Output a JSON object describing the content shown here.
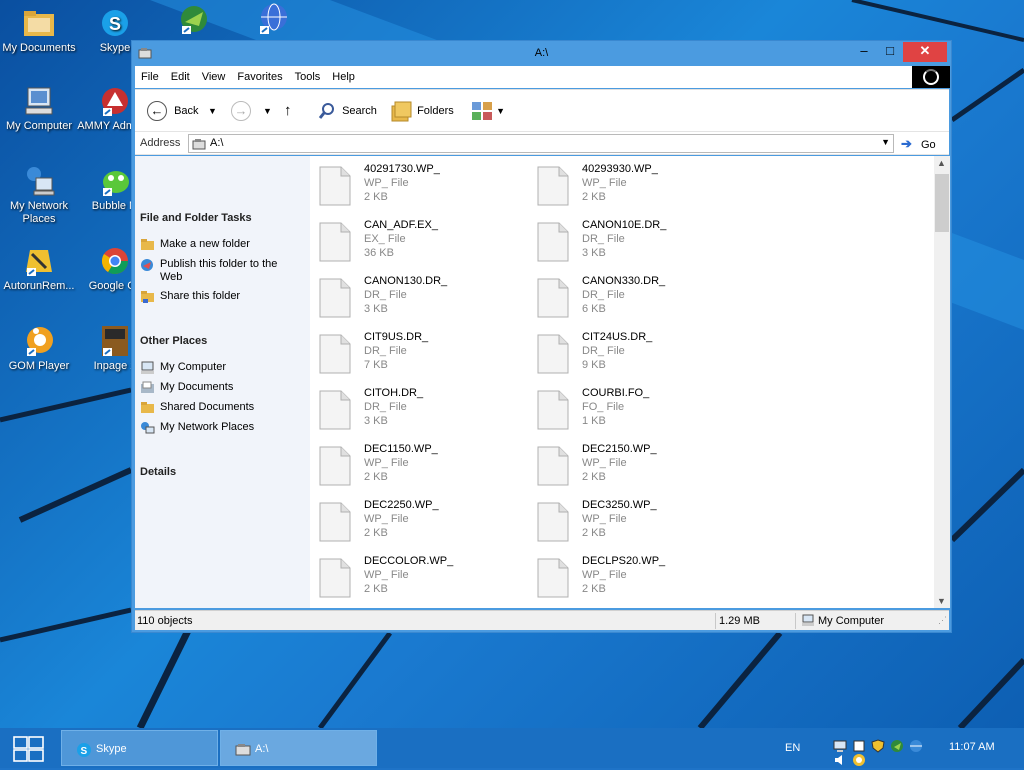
{
  "desktop": {
    "icons": [
      {
        "label": "My Documents"
      },
      {
        "label": "Skype"
      },
      {
        "label": ""
      },
      {
        "label": ""
      },
      {
        "label": "My Computer"
      },
      {
        "label": "AMMY Admin.e"
      },
      {
        "label": "My Network Places"
      },
      {
        "label": "Bubble M"
      },
      {
        "label": "AutorunRem..."
      },
      {
        "label": "Google Ch"
      },
      {
        "label": "GOM Player"
      },
      {
        "label": "Inpage 2"
      }
    ]
  },
  "window": {
    "title": "A:\\",
    "controls": {
      "minimize": "–",
      "maximize": "□",
      "close": "✕"
    }
  },
  "menu": [
    "File",
    "Edit",
    "View",
    "Favorites",
    "Tools",
    "Help"
  ],
  "toolbar": {
    "back": "Back",
    "search": "Search",
    "folders": "Folders"
  },
  "address": {
    "label": "Address",
    "value": "A:\\",
    "go": "Go"
  },
  "tasks": {
    "file_folder_header": "File and Folder Tasks",
    "file_folder_items": [
      "Make a new folder",
      "Publish this folder to the Web",
      "Share this folder"
    ],
    "other_places_header": "Other Places",
    "other_places_items": [
      "My Computer",
      "My Documents",
      "Shared Documents",
      "My Network Places"
    ],
    "details_header": "Details"
  },
  "files": [
    {
      "name": "40291730.WP_",
      "type": "WP_ File",
      "size": "2 KB"
    },
    {
      "name": "40293930.WP_",
      "type": "WP_ File",
      "size": "2 KB"
    },
    {
      "name": "CAN_ADF.EX_",
      "type": "EX_ File",
      "size": "36 KB"
    },
    {
      "name": "CANON10E.DR_",
      "type": "DR_ File",
      "size": "3 KB"
    },
    {
      "name": "CANON130.DR_",
      "type": "DR_ File",
      "size": "3 KB"
    },
    {
      "name": "CANON330.DR_",
      "type": "DR_ File",
      "size": "6 KB"
    },
    {
      "name": "CIT9US.DR_",
      "type": "DR_ File",
      "size": "7 KB"
    },
    {
      "name": "CIT24US.DR_",
      "type": "DR_ File",
      "size": "9 KB"
    },
    {
      "name": "CITOH.DR_",
      "type": "DR_ File",
      "size": "3 KB"
    },
    {
      "name": "COURBI.FO_",
      "type": "FO_ File",
      "size": "1 KB"
    },
    {
      "name": "DEC1150.WP_",
      "type": "WP_ File",
      "size": "2 KB"
    },
    {
      "name": "DEC2150.WP_",
      "type": "WP_ File",
      "size": "2 KB"
    },
    {
      "name": "DEC2250.WP_",
      "type": "WP_ File",
      "size": "2 KB"
    },
    {
      "name": "DEC3250.WP_",
      "type": "WP_ File",
      "size": "2 KB"
    },
    {
      "name": "DECCOLOR.WP_",
      "type": "WP_ File",
      "size": "2 KB"
    },
    {
      "name": "DECLPS20.WP_",
      "type": "WP_ File",
      "size": "2 KB"
    }
  ],
  "status": {
    "objects": "110 objects",
    "size": "1.29 MB",
    "location": "My Computer"
  },
  "taskbar": {
    "buttons": [
      {
        "label": "Skype"
      },
      {
        "label": "A:\\"
      }
    ],
    "lang": "EN",
    "clock": "11:07 AM"
  },
  "colors": {
    "accent": "#1a6fc2",
    "close": "#e04343",
    "window_frame": "#4b9be0"
  }
}
